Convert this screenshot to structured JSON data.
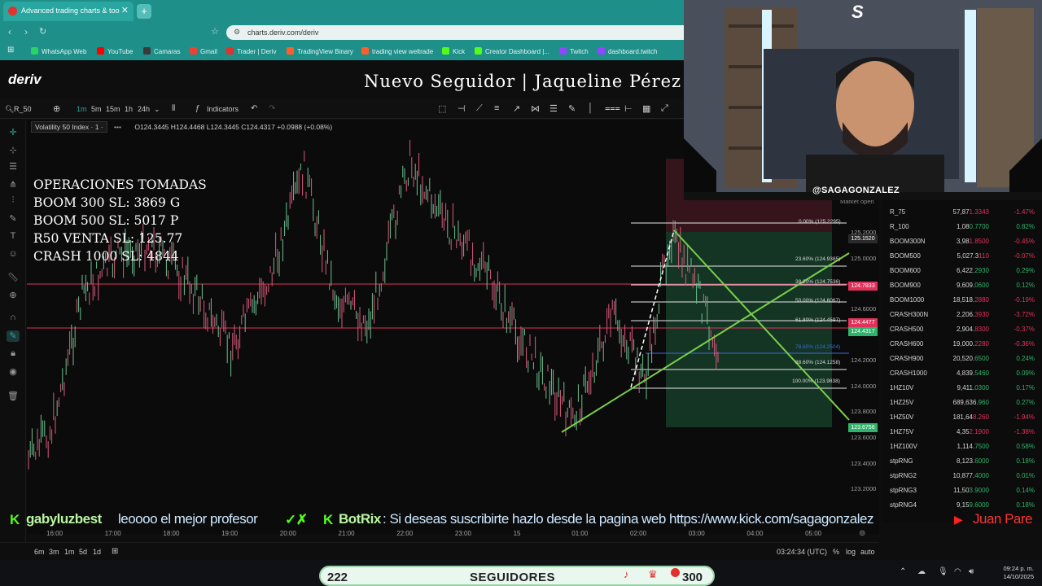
{
  "browser": {
    "tab_title": "Advanced trading charts & too",
    "url": "charts.deriv.com/deriv",
    "bookmarks": [
      {
        "label": "WhatsApp Web",
        "color": "#25d366"
      },
      {
        "label": "YouTube",
        "color": "#ff0000"
      },
      {
        "label": "Camaras",
        "color": "#3a3a3a"
      },
      {
        "label": "Gmail",
        "color": "#ea4335"
      },
      {
        "label": "Trader | Deriv",
        "color": "#e0322f"
      },
      {
        "label": "TradingView Binary",
        "color": "#ff5e2b"
      },
      {
        "label": "trading view weltrade",
        "color": "#ff5e2b"
      },
      {
        "label": "Kick",
        "color": "#53fc18"
      },
      {
        "label": "Creator Dashboard |...",
        "color": "#53fc18"
      },
      {
        "label": "Twitch",
        "color": "#9146ff"
      },
      {
        "label": "dashboard.twitch",
        "color": "#9146ff"
      }
    ]
  },
  "app": {
    "logo": "deriv",
    "notice": "Nuevo Seguidor | Jaqueline Pérez"
  },
  "toolbar": {
    "symbol": "R_50",
    "timeframes": [
      "1m",
      "5m",
      "15m",
      "1h",
      "24h"
    ],
    "indicators_label": "Indicators"
  },
  "legend": {
    "symbol_name": "Volatility 50 Index · 1 ·",
    "ohlc": "O124.3445 H124.4468 L124.3445 C124.4317 +0.0988 (+0.08%)"
  },
  "operations_overlay": {
    "lines": [
      "OPERACIONES TOMADAS",
      "BOOM 300 SL: 3869 G",
      "BOOM 500 SL: 5017 P",
      "R50 VENTA SL: 125.77",
      "CRASH 1000 SL: 4844"
    ]
  },
  "price_axis": [
    "125.2000",
    "125.0000",
    "124.6000",
    "124.2000",
    "124.0000",
    "123.8000",
    "123.6000",
    "123.4000",
    "123.2000"
  ],
  "price_badges": [
    {
      "label": "125.1520",
      "color": "#2a2a2a"
    },
    {
      "label": "124.7833",
      "color": "#e0325a"
    },
    {
      "label": "124.4477",
      "color": "#e0325a"
    },
    {
      "label": "124.4317",
      "color": "#2fb36a"
    },
    {
      "label": "123.6756",
      "color": "#2fb36a"
    }
  ],
  "fibonacci": [
    "0.00% (125.2295)",
    "23.60% (124.9385)",
    "38.20% (124.7536)",
    "50.00% (124.6067)",
    "61.80% (124.4597)",
    "78.60% (124.2504)",
    "88.60% (124.1258)",
    "100.00% (123.9838)"
  ],
  "time_axis": [
    "16:00",
    "17:00",
    "18:00",
    "19:00",
    "20:00",
    "21:00",
    "22:00",
    "23:00",
    "15",
    "01:00",
    "02:00",
    "03:00",
    "04:00",
    "05:00"
  ],
  "bottom_bar": {
    "ranges": [
      "6m",
      "3m",
      "1m",
      "5d",
      "1d"
    ],
    "time_utc": "03:24:34 (UTC)",
    "options": [
      "%",
      "log",
      "auto"
    ]
  },
  "watchlist": {
    "header": "Market open",
    "partial_value": "124.4222",
    "rows": [
      {
        "name": "R_75",
        "value_main": "57,87",
        "value_tail": "1.3343",
        "change": "-1.47%",
        "up": false
      },
      {
        "name": "R_100",
        "value_main": "1,08",
        "value_tail": "0.7700",
        "change": "0.82%",
        "up": true
      },
      {
        "name": "BOOM300N",
        "value_main": "3,98",
        "value_tail": "1.8500",
        "change": "-0.45%",
        "up": false
      },
      {
        "name": "BOOM500",
        "value_main": "5,027.3",
        "value_tail": "110",
        "change": "-0.07%",
        "up": false
      },
      {
        "name": "BOOM600",
        "value_main": "6,422.",
        "value_tail": "2930",
        "change": "0.29%",
        "up": true
      },
      {
        "name": "BOOM900",
        "value_main": "9,609.",
        "value_tail": "0600",
        "change": "0.12%",
        "up": true
      },
      {
        "name": "BOOM1000",
        "value_main": "18,518.",
        "value_tail": "2880",
        "change": "-0.19%",
        "up": false
      },
      {
        "name": "CRASH300N",
        "value_main": "2,206.",
        "value_tail": "3930",
        "change": "-3.72%",
        "up": false
      },
      {
        "name": "CRASH500",
        "value_main": "2,904.",
        "value_tail": "8300",
        "change": "-0.37%",
        "up": false
      },
      {
        "name": "CRASH600",
        "value_main": "19,000.",
        "value_tail": "2280",
        "change": "-0.36%",
        "up": false
      },
      {
        "name": "CRASH900",
        "value_main": "20,520.",
        "value_tail": "6500",
        "change": "0.24%",
        "up": true
      },
      {
        "name": "CRASH1000",
        "value_main": "4,839.",
        "value_tail": "5460",
        "change": "0.09%",
        "up": true
      },
      {
        "name": "1HZ10V",
        "value_main": "9,411.",
        "value_tail": "0300",
        "change": "0.17%",
        "up": true
      },
      {
        "name": "1HZ25V",
        "value_main": "689,636.",
        "value_tail": "960",
        "change": "0.27%",
        "up": true
      },
      {
        "name": "1HZ50V",
        "value_main": "181,64",
        "value_tail": "8.260",
        "change": "-1.94%",
        "up": false
      },
      {
        "name": "1HZ75V",
        "value_main": "4,35",
        "value_tail": "2.1900",
        "change": "-1.38%",
        "up": false
      },
      {
        "name": "1HZ100V",
        "value_main": "1,114.",
        "value_tail": "7500",
        "change": "0.58%",
        "up": true
      },
      {
        "name": "stpRNG",
        "value_main": "8,123.",
        "value_tail": "6000",
        "change": "0.18%",
        "up": true
      },
      {
        "name": "stpRNG2",
        "value_main": "10,877.",
        "value_tail": "4000",
        "change": "0.01%",
        "up": true
      },
      {
        "name": "stpRNG3",
        "value_main": "11,50",
        "value_tail": "3.9000",
        "change": "0.14%",
        "up": true
      },
      {
        "name": "stpRNG4",
        "value_main": "9,15",
        "value_tail": "9.6000",
        "change": "0.18%",
        "up": true
      }
    ]
  },
  "webcam": {
    "handle": "@SAGAGONZALEZ"
  },
  "chat_ticker": {
    "user1": "gabyluzbest",
    "msg1": "leoooo el mejor profesor",
    "user2": "BotRix",
    "msg2": ": Si deseas suscribirte hazlo desde la pagina web https://www.kick.com/sagagonzalez",
    "user3": "Juan Pare"
  },
  "followers_goal": {
    "current": "222",
    "label": "SEGUIDORES",
    "target": "300"
  },
  "taskbar": {
    "time": "09:24 p. m.",
    "date": "14/10/2025"
  },
  "colors": {
    "accent": "#2aa6a0",
    "bull": "#2fb36a",
    "bear": "#e0325a"
  }
}
